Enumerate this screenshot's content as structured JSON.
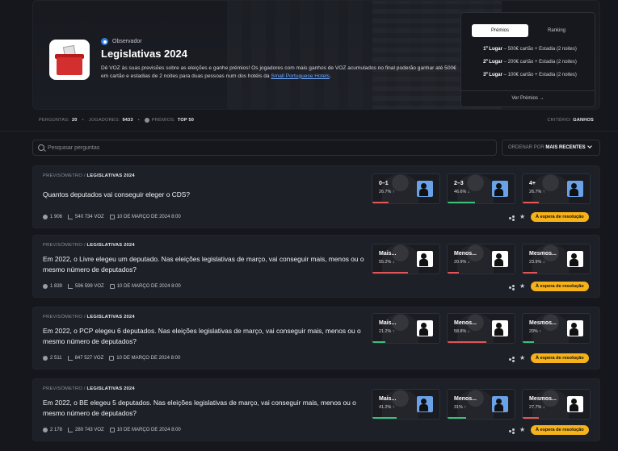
{
  "hero": {
    "publisher": "Observador",
    "title": "Legislativas 2024",
    "description": "Dê VOZ às suas previsões sobre as eleições e ganhe prémios! Os jogadores com mais ganhos de VOZ acumulados no final poderão ganhar até 500€ em cartão e estadias de 2 noites para duas pessoas num dos hotéis da ",
    "link": "Small Portuguese Hotels",
    "description_end": "."
  },
  "prizes": {
    "tabs": [
      "Prémios",
      "Ranking"
    ],
    "rows": [
      {
        "place": "1º Lugar",
        "reward": " – 500€ cartão + Estadia (2 noites)"
      },
      {
        "place": "2º Lugar",
        "reward": " – 200€ cartão + Estadia (2 noites)"
      },
      {
        "place": "3º Lugar",
        "reward": " – 100€ cartão + Estadia (2 noites)"
      }
    ],
    "see_all": "Ver Prémios  →"
  },
  "stats": {
    "questions_label": "PERGUNTAS:",
    "questions_value": "20",
    "players_label": "JOGADORES:",
    "players_value": "9433",
    "prizes_label": "PRÉMIOS:",
    "prizes_value": "TOP 50",
    "criteria_label": "CRITÉRIO:",
    "criteria_value": "GANHOS"
  },
  "search": {
    "placeholder": "Pesquisar perguntas"
  },
  "sort": {
    "label": "ORDENAR POR",
    "value": "MAIS RECENTES"
  },
  "questions": [
    {
      "crumb_a": "PREVISÓMETRO",
      "crumb_b": "LEGISLATIVAS 2024",
      "text": "Quantos deputados vai conseguir eleger o CDS?",
      "players": "1 906",
      "voz": "540 734 VOZ",
      "date": "10 DE MARÇO DE 2024 8:00",
      "status": "À espera de resolução",
      "options": [
        {
          "label": "0–1",
          "pct": "26.7% ↑"
        },
        {
          "label": "2–3",
          "pct": "46.6% ↓"
        },
        {
          "label": "4+",
          "pct": "26.7% ↑"
        }
      ]
    },
    {
      "crumb_a": "PREVISÓMETRO",
      "crumb_b": "LEGISLATIVAS 2024",
      "text": "Em 2022, o Livre elegeu um deputado. Nas eleições legislativas de março, vai conseguir mais, menos ou o mesmo número de deputados?",
      "players": "1 839",
      "voz": "596 599 VOZ",
      "date": "10 DE MARÇO DE 2024 8:00",
      "status": "À espera de resolução",
      "options": [
        {
          "label": "Mais...",
          "pct": "55.2% ↓"
        },
        {
          "label": "Menos...",
          "pct": "20.9% ↓"
        },
        {
          "label": "Mesmos...",
          "pct": "23.9% ↓"
        }
      ]
    },
    {
      "crumb_a": "PREVISÓMETRO",
      "crumb_b": "LEGISLATIVAS 2024",
      "text": "Em 2022, o PCP elegeu 6 deputados. Nas eleições legislativas de março, vai conseguir mais, menos ou o mesmo número de deputados?",
      "players": "2 511",
      "voz": "847 527 VOZ",
      "date": "10 DE MARÇO DE 2024 8:00",
      "status": "À espera de resolução",
      "options": [
        {
          "label": "Mais...",
          "pct": "21.2% ↑"
        },
        {
          "label": "Menos...",
          "pct": "58.8% ↓"
        },
        {
          "label": "Mesmos...",
          "pct": "20% ↑"
        }
      ]
    },
    {
      "crumb_a": "PREVISÓMETRO",
      "crumb_b": "LEGISLATIVAS 2024",
      "text": "Em 2022, o BE elegeu 5 deputados. Nas eleições legislativas de março, vai conseguir mais, menos ou o mesmo número de deputados?",
      "players": "2 178",
      "voz": "280 743 VOZ",
      "date": "10 DE MARÇO DE 2024 8:00",
      "status": "À espera de resolução",
      "options": [
        {
          "label": "Mais...",
          "pct": "41.2% ↑"
        },
        {
          "label": "Menos...",
          "pct": "31% ↑"
        },
        {
          "label": "Mesmos...",
          "pct": "27.7% ↓"
        }
      ]
    }
  ],
  "colors": {
    "status": "#f5b21a",
    "up": "#3cc07a",
    "down": "#e05555",
    "link": "#6fa8ff"
  }
}
